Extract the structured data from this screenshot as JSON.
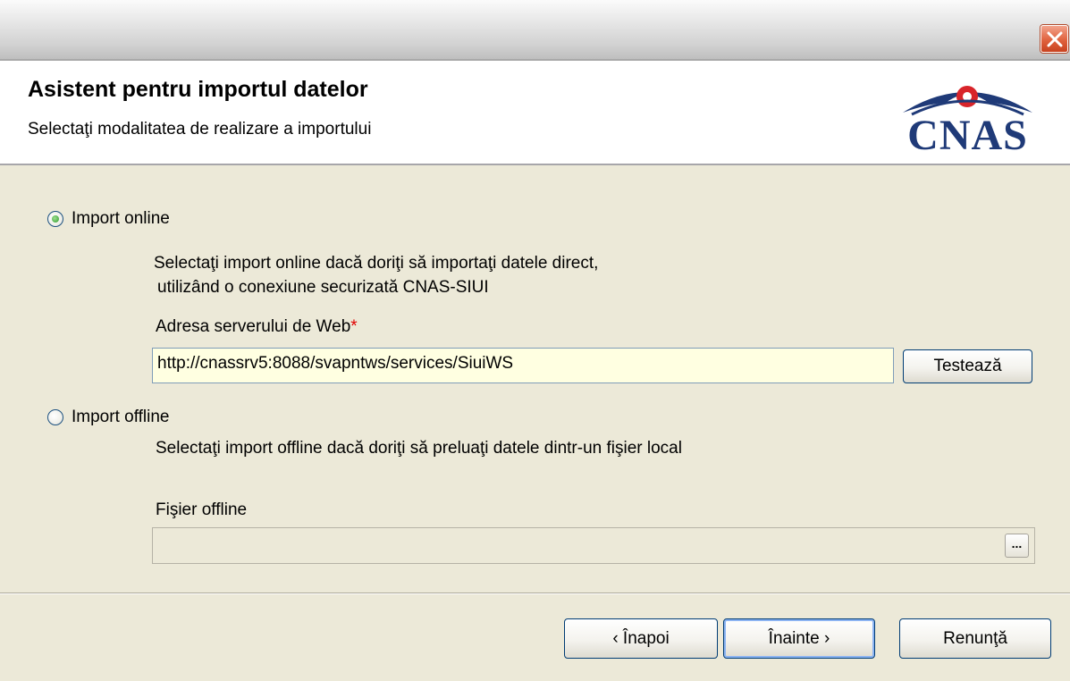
{
  "window": {
    "close_icon": "close-icon"
  },
  "header": {
    "title": "Asistent pentru importul datelor",
    "subtitle": "Selectaţi modalitatea de realizare a importului",
    "logo_text": "CNAS"
  },
  "online": {
    "label": "Import online",
    "selected": true,
    "description_line1": "Selectaţi import online dacă doriţi să importaţi datele direct,",
    "description_line2": "utilizând o conexiune securizată CNAS-SIUI",
    "server_label": "Adresa serverului de Web",
    "required_mark": "*",
    "server_value": "http://cnassrv5:8088/svapntws/services/SiuiWS",
    "test_button": "Testează"
  },
  "offline": {
    "label": "Import offline",
    "selected": false,
    "description": "Selectaţi import offline dacă doriţi să preluaţi datele dintr-un fişier local",
    "file_label": "Fişier offline",
    "file_value": "",
    "browse_button": "..."
  },
  "footer": {
    "back_button": "‹ Înapoi",
    "next_button": "Înainte ›",
    "cancel_button": "Renunţă"
  },
  "colors": {
    "logo_blue": "#1f3a78",
    "logo_red": "#d8242a",
    "required": "#e00000",
    "active_field": "#ffffe1"
  }
}
